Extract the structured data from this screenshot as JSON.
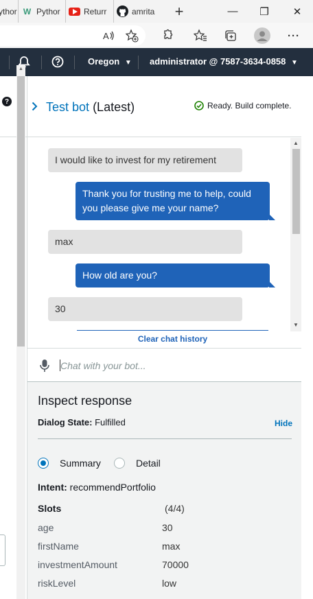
{
  "browser": {
    "tabs": [
      {
        "label": "Pythor",
        "icon": "python-tab-icon"
      },
      {
        "label": "Pythor",
        "icon": "w-tab-icon"
      },
      {
        "label": "Returr",
        "icon": "youtube-tab-icon"
      },
      {
        "label": "amrita",
        "icon": "github-tab-icon"
      }
    ],
    "new_tab": "+",
    "window_controls": {
      "minimize": "—",
      "restore": "❐",
      "close": "✕"
    },
    "toolbar_icons": [
      "read-aloud-icon",
      "add-favorite-icon",
      "extensions-icon",
      "favorites-icon",
      "collections-icon",
      "profile-icon",
      "more-icon"
    ]
  },
  "aws_header": {
    "region": "Oregon",
    "account": "administrator @ 7587-3634-0858"
  },
  "test_bot": {
    "title": "Test bot",
    "version": "(Latest)",
    "status": "Ready. Build complete.",
    "status_color": "#1d8102",
    "messages": [
      {
        "from": "user",
        "text": "I would like to invest for my retirement"
      },
      {
        "from": "bot",
        "text": "Thank you for trusting me to help, could you please give me your name?"
      },
      {
        "from": "user",
        "text": "max"
      },
      {
        "from": "bot",
        "text": "How old are you?"
      },
      {
        "from": "user",
        "text": "30"
      }
    ],
    "clear_history": "Clear chat history",
    "input_placeholder": "Chat with your bot...",
    "accent_color": "#1f63b8"
  },
  "inspect_response": {
    "title": "Inspect response",
    "dialog_state_label": "Dialog State:",
    "dialog_state_value": "Fulfilled",
    "hide": "Hide",
    "view_options": [
      "Summary",
      "Detail"
    ],
    "selected_view": "Summary",
    "intent_label": "Intent:",
    "intent_value": "recommendPortfolio",
    "slots_label": "Slots",
    "slots_count": "(4/4)",
    "slots": [
      {
        "name": "age",
        "value": "30"
      },
      {
        "name": "firstName",
        "value": "max"
      },
      {
        "name": "investmentAmount",
        "value": "70000"
      },
      {
        "name": "riskLevel",
        "value": "low"
      }
    ]
  }
}
